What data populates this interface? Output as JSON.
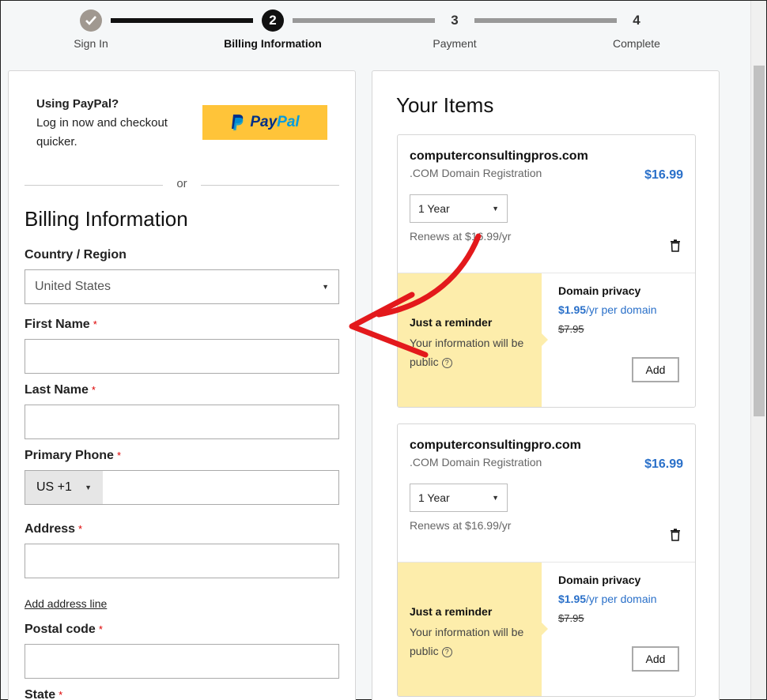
{
  "stepper": {
    "steps": [
      {
        "number": "",
        "label": "Sign In",
        "state": "done"
      },
      {
        "number": "2",
        "label": "Billing Information",
        "state": "active"
      },
      {
        "number": "3",
        "label": "Payment",
        "state": "todo"
      },
      {
        "number": "4",
        "label": "Complete",
        "state": "todo"
      }
    ]
  },
  "paypal": {
    "heading": "Using PayPal?",
    "text": "Log in now and checkout quicker.",
    "button_part1": "Pay",
    "button_part2": "Pal"
  },
  "divider_text": "or",
  "billing": {
    "title": "Billing Information",
    "country_label": "Country / Region",
    "country_value": "United States",
    "first_name_label": "First Name",
    "last_name_label": "Last Name",
    "phone_label": "Primary Phone",
    "phone_code": "US +1",
    "address_label": "Address",
    "add_address_line": "Add address line",
    "postal_label": "Postal code",
    "state_label": "State",
    "required_mark": "*"
  },
  "items": {
    "title": "Your Items",
    "list": [
      {
        "domain": "computerconsultingpros.com",
        "type": ".COM Domain Registration",
        "price": "$16.99",
        "term": "1 Year",
        "renews": "Renews at $16.99/yr",
        "reminder_title": "Just a reminder",
        "reminder_text": "Your information will be public",
        "privacy_title": "Domain privacy",
        "privacy_price": "$1.95",
        "privacy_unit": "/yr per domain",
        "privacy_old": "$7.95",
        "add_label": "Add"
      },
      {
        "domain": "computerconsultingpro.com",
        "type": ".COM Domain Registration",
        "price": "$16.99",
        "term": "1 Year",
        "renews": "Renews at $16.99/yr",
        "reminder_title": "Just a reminder",
        "reminder_text": "Your information will be public",
        "privacy_title": "Domain privacy",
        "privacy_price": "$1.95",
        "privacy_unit": "/yr per domain",
        "privacy_old": "$7.95",
        "add_label": "Add"
      }
    ]
  },
  "colors": {
    "accent_blue": "#2a70c9",
    "paypal_yellow": "#ffc439",
    "reminder_yellow": "#fdedab",
    "annotation_red": "#e3191c"
  },
  "icons": {
    "done_step": "checkmark-icon",
    "remove_item": "trash-icon",
    "info": "info-icon",
    "dropdown": "caret-down-icon"
  }
}
